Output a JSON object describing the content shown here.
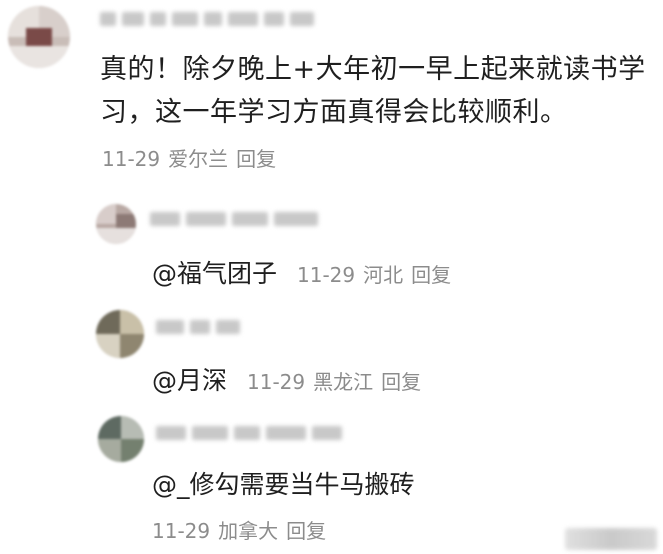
{
  "top_comment": {
    "text": "真的！除夕晚上+大年初一早上起来就读书学习，这一年学习方面真得会比较顺利。",
    "date": "11-29",
    "location": "爱尔兰",
    "reply_label": "回复"
  },
  "replies": [
    {
      "mention": "@福气团子",
      "date": "11-29",
      "location": "河北",
      "reply_label": "回复"
    },
    {
      "mention": "@月深",
      "date": "11-29",
      "location": "黑龙江",
      "reply_label": "回复"
    },
    {
      "mention": "@_修勾需要当牛马搬砖",
      "date": "11-29",
      "location": "加拿大",
      "reply_label": "回复"
    }
  ]
}
